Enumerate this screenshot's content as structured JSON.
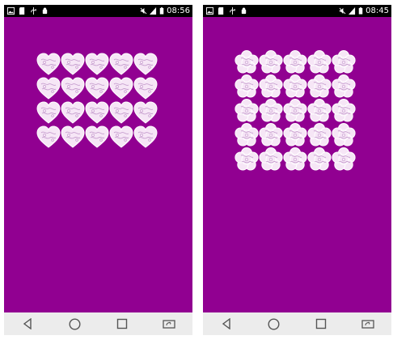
{
  "screens": [
    {
      "id": "left",
      "time": "08:56",
      "shape": "heart",
      "grid": {
        "rows": 4,
        "cols": 5
      },
      "background": "#910091"
    },
    {
      "id": "right",
      "time": "08:45",
      "shape": "flower",
      "grid": {
        "rows": 5,
        "cols": 5
      },
      "background": "#910091"
    }
  ],
  "status_icons_left": [
    "image-icon",
    "sd-card-icon",
    "usb-icon",
    "android-debug-icon"
  ],
  "status_icons_right": [
    "mute-icon",
    "signal-icon",
    "battery-icon"
  ],
  "nav_buttons": [
    "back-button",
    "home-button",
    "recents-button",
    "rotate-button"
  ],
  "colors": {
    "primary": "#910091",
    "statusbar": "#000000",
    "navbar": "#ececec",
    "tile_fill": "#f6e6f6",
    "tile_line": "#c79fcf"
  }
}
